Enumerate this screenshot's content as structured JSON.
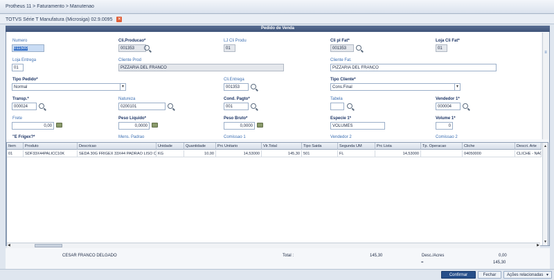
{
  "breadcrumb": "Protheus 11 > Faturamento > Manutenao",
  "window": {
    "title": "TOTVS Série T Manufatura (Microsiga) 02.9.0095"
  },
  "panel": {
    "title": "Pedido de Venda"
  },
  "form": {
    "numero": {
      "label": "Numero",
      "value": "011500"
    },
    "cli_producao": {
      "label": "Cli.Producao*",
      "value": "001353"
    },
    "lj_cli_prodo": {
      "label": "LJ Cli Produ",
      "value": "01"
    },
    "cli_pl_fat": {
      "label": "Cli pl Fat*",
      "value": "001353"
    },
    "loja_cli_fat": {
      "label": "Loja Cli Fat*",
      "value": "01"
    },
    "loja_entrega": {
      "label": "Loja Entrega",
      "value": "01"
    },
    "cliente_prod": {
      "label": "Cliente Prod",
      "value": "PIZZARIA DEL FRANCO"
    },
    "cliente_fat": {
      "label": "Cliente Fat.",
      "value": "PIZZARIA DEL FRANCO"
    },
    "tipo_pedido": {
      "label": "Tipo Pedido*",
      "value": "Normal"
    },
    "cli_entrega": {
      "label": "Cli.Entrega",
      "value": "001353"
    },
    "tipo_cliente": {
      "label": "Tipo Cliente*",
      "value": "Cons.Final"
    },
    "transp": {
      "label": "Transp.*",
      "value": "000024"
    },
    "natureza": {
      "label": "Natureza",
      "value": "0200101"
    },
    "cond_pagto": {
      "label": "Cond. Pagto*",
      "value": "001"
    },
    "tabela": {
      "label": "Tabela",
      "value": ""
    },
    "vendedor1": {
      "label": "Vendedor 1*",
      "value": "000004"
    },
    "frete": {
      "label": "Frete",
      "value": "0,00"
    },
    "peso_liquido": {
      "label": "Peso Liquido*",
      "value": "0,0000"
    },
    "peso_bruto": {
      "label": "Peso Bruto*",
      "value": "0,0000"
    },
    "especie1": {
      "label": "Especie 1*",
      "value": "VOLUMES"
    },
    "volume1": {
      "label": "Volume 1*",
      "value": "0"
    },
    "e_frigex": {
      "label": "\"E Frigex?*"
    },
    "mens_padrao": {
      "label": "Mens. Padrao"
    },
    "comissao1": {
      "label": "Comissao 1"
    },
    "vendedor2": {
      "label": "Vendedor 2"
    },
    "comissao2": {
      "label": "Comissao 2"
    }
  },
  "grid": {
    "columns": [
      "Item",
      "Produto",
      "Descricao",
      "Unidade",
      "Quantidade",
      "Prc Unitario",
      "Vlr.Total",
      "Tipo Saida",
      "Segunda UM",
      "Prc Lista",
      "Tp. Operacao",
      "Cliche",
      "Descri. Arte"
    ],
    "rows": [
      [
        "01",
        "SDF33X44PALICC10K",
        "SEDA 30G FRIGEX 33X44 PADRAO LISO CO",
        "KG",
        "10,00",
        "14,53000",
        "145,30",
        "501",
        "FL",
        "14,53000",
        "",
        "04050000",
        "CLICHE - NAO L"
      ]
    ]
  },
  "footer": {
    "customer": "CESAR FRANCO DELGADO",
    "total_label": "Total :",
    "total_value": "145,30",
    "desc_label": "Desc./Acres",
    "desc_value": "0,00",
    "eq_label": "=",
    "eq_value": "145,30"
  },
  "buttons": {
    "confirm": "Confirmar",
    "close": "Fechar",
    "actions": "Ações relacionadas"
  }
}
